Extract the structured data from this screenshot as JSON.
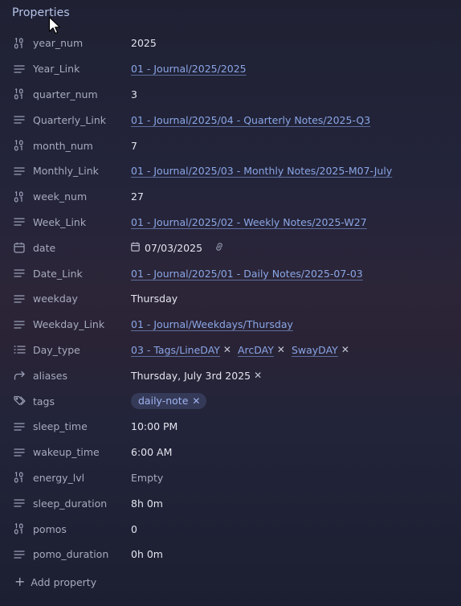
{
  "header": {
    "title": "Properties"
  },
  "properties": [
    {
      "icon": "number-icon",
      "key": "year_num",
      "type": "text",
      "value": "2025"
    },
    {
      "icon": "text-lines-icon",
      "key": "Year_Link",
      "type": "link",
      "value": "01 - Journal/2025/2025"
    },
    {
      "icon": "number-icon",
      "key": "quarter_num",
      "type": "text",
      "value": "3"
    },
    {
      "icon": "text-lines-icon",
      "key": "Quarterly_Link",
      "type": "link",
      "value": "01 - Journal/2025/04 - Quarterly Notes/2025-Q3"
    },
    {
      "icon": "number-icon",
      "key": "month_num",
      "type": "text",
      "value": "7"
    },
    {
      "icon": "text-lines-icon",
      "key": "Monthly_Link",
      "type": "link",
      "value": "01 - Journal/2025/03 - Monthly Notes/2025-M07-July"
    },
    {
      "icon": "number-icon",
      "key": "week_num",
      "type": "text",
      "value": "27"
    },
    {
      "icon": "text-lines-icon",
      "key": "Week_Link",
      "type": "link",
      "value": "01 - Journal/2025/02 - Weekly Notes/2025-W27"
    },
    {
      "icon": "calendar-icon",
      "key": "date",
      "type": "date",
      "value": "07/03/2025"
    },
    {
      "icon": "text-lines-icon",
      "key": "Date_Link",
      "type": "link",
      "value": "01 - Journal/2025/01 - Daily Notes/2025-07-03"
    },
    {
      "icon": "text-lines-icon",
      "key": "weekday",
      "type": "text",
      "value": "Thursday"
    },
    {
      "icon": "text-lines-icon",
      "key": "Weekday_Link",
      "type": "link",
      "value": "01 - Journal/Weekdays/Thursday"
    },
    {
      "icon": "list-icon",
      "key": "Day_type",
      "type": "multi-link",
      "values": [
        "03 - Tags/LineDAY",
        "ArcDAY",
        "SwayDAY"
      ]
    },
    {
      "icon": "forward-arrow-icon",
      "key": "aliases",
      "type": "multi-text",
      "values": [
        "Thursday, July 3rd 2025"
      ]
    },
    {
      "icon": "tags-icon",
      "key": "tags",
      "type": "tags",
      "values": [
        "daily-note"
      ]
    },
    {
      "icon": "text-lines-icon",
      "key": "sleep_time",
      "type": "text",
      "value": "10:00 PM"
    },
    {
      "icon": "text-lines-icon",
      "key": "wakeup_time",
      "type": "text",
      "value": "6:00 AM"
    },
    {
      "icon": "number-icon",
      "key": "energy_lvl",
      "type": "empty",
      "value": "Empty"
    },
    {
      "icon": "text-lines-icon",
      "key": "sleep_duration",
      "type": "text",
      "value": "8h 0m"
    },
    {
      "icon": "number-icon",
      "key": "pomos",
      "type": "text",
      "value": "0"
    },
    {
      "icon": "text-lines-icon",
      "key": "pomo_duration",
      "type": "text",
      "value": "0h 0m"
    }
  ],
  "footer": {
    "add_label": "Add property"
  },
  "colors": {
    "link": "#8aa6e6",
    "tag_bg": "#353a58",
    "tag_text": "#9fb3ef",
    "header": "#b7c4ea"
  }
}
